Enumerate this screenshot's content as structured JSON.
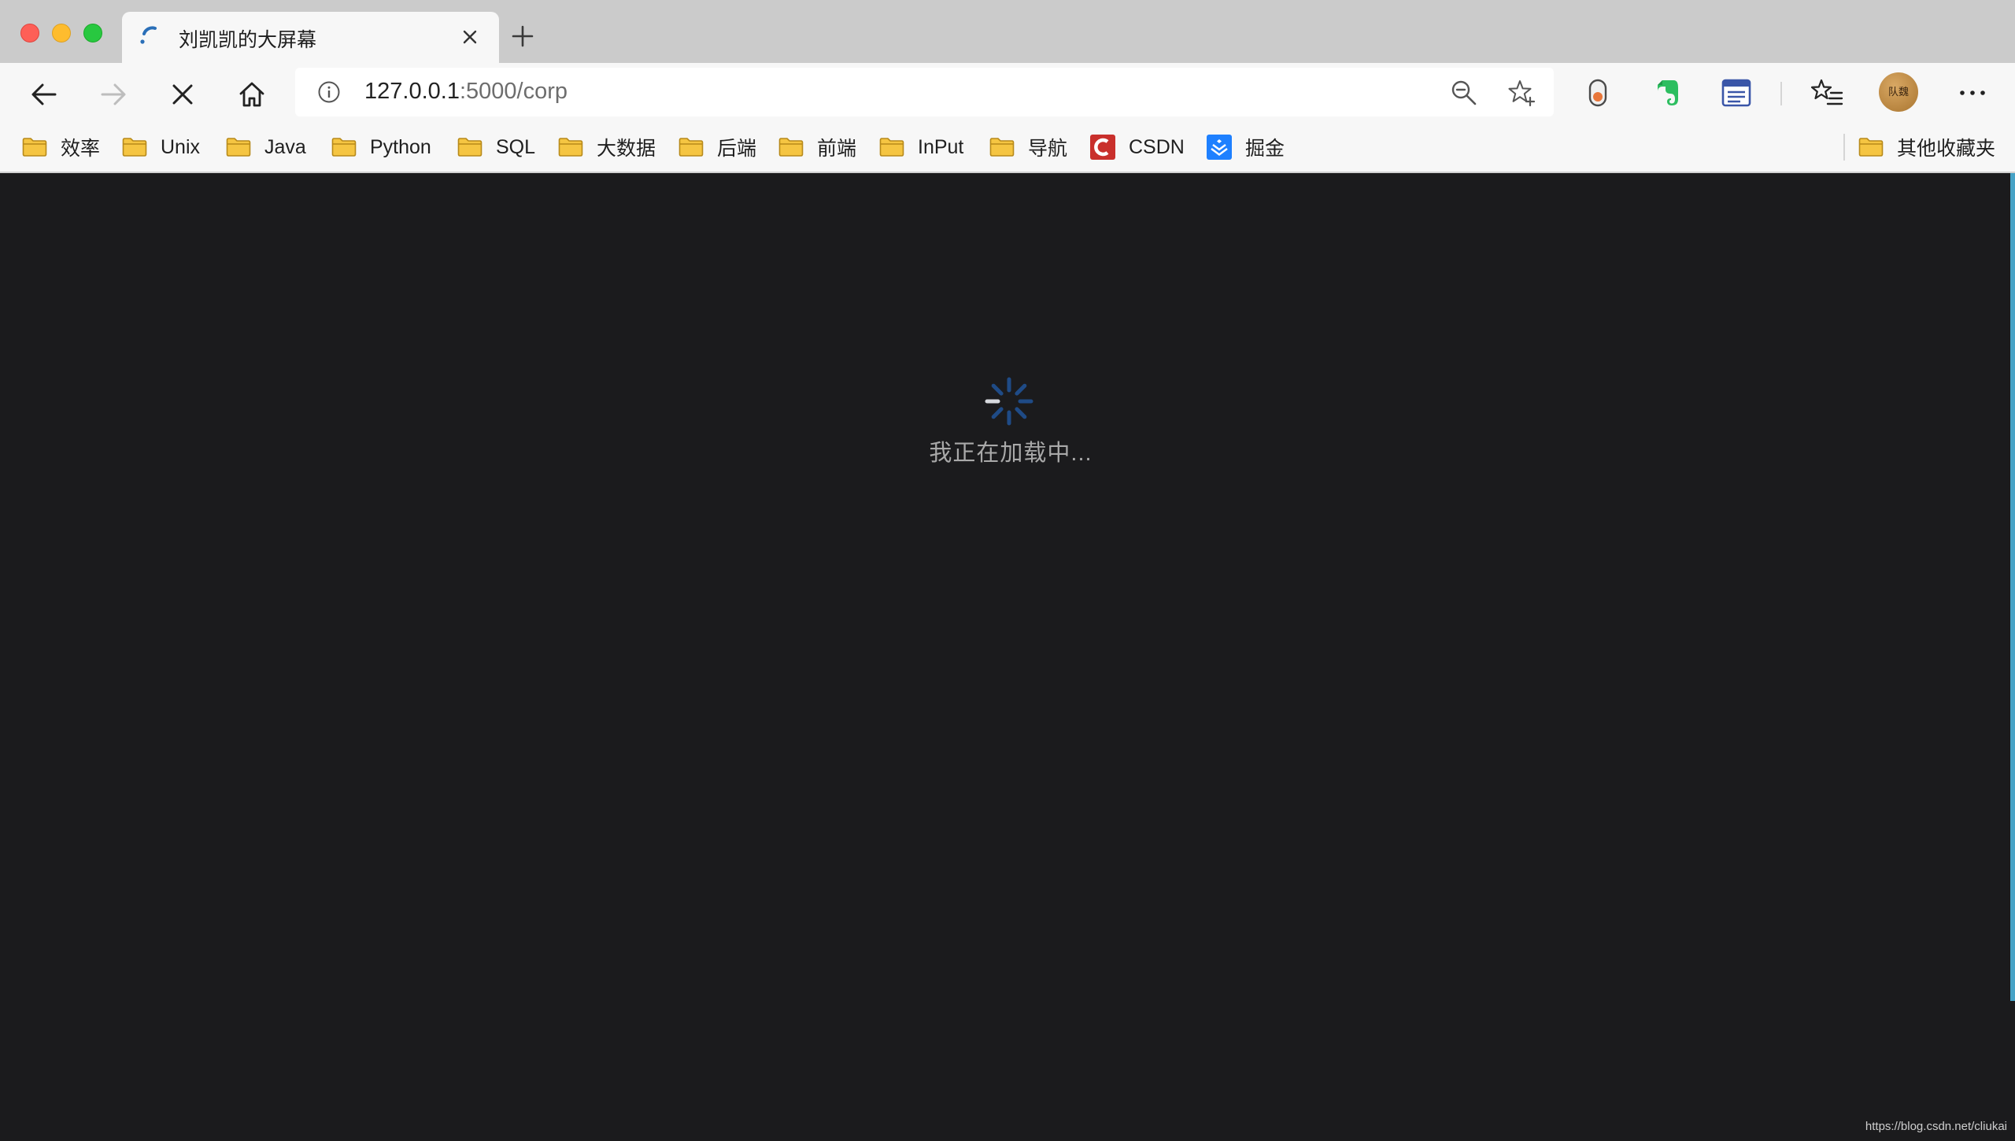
{
  "tab": {
    "title": "刘凯凯的大屏幕"
  },
  "address": {
    "host": "127.0.0.1",
    "rest": ":5000/corp"
  },
  "bookmarks": [
    {
      "label": "效率",
      "icon": "folder-icon"
    },
    {
      "label": "Unix",
      "icon": "folder-icon"
    },
    {
      "label": "Java",
      "icon": "folder-icon"
    },
    {
      "label": "Python",
      "icon": "folder-icon"
    },
    {
      "label": "SQL",
      "icon": "folder-icon"
    },
    {
      "label": "大数据",
      "icon": "folder-icon"
    },
    {
      "label": "后端",
      "icon": "folder-icon"
    },
    {
      "label": "前端",
      "icon": "folder-icon"
    },
    {
      "label": "InPut",
      "icon": "folder-icon"
    },
    {
      "label": "导航",
      "icon": "folder-icon"
    },
    {
      "label": "CSDN",
      "icon": "csdn-icon"
    },
    {
      "label": "掘金",
      "icon": "juejin-icon"
    }
  ],
  "other_bookmarks": {
    "label": "其他收藏夹",
    "icon": "folder-icon"
  },
  "avatar": {
    "text": "队魏"
  },
  "content": {
    "loading_text": "我正在加载中...",
    "watermark": "https://blog.csdn.net/cliukai"
  },
  "colors": {
    "page_background": "#1b1b1d",
    "spinner": "#1f4b86",
    "folder": "#f5c542",
    "csdn": "#c9302c",
    "juejin": "#1e80ff",
    "evernote": "#2dbe60",
    "scroll_accent": "#46a2c6"
  }
}
